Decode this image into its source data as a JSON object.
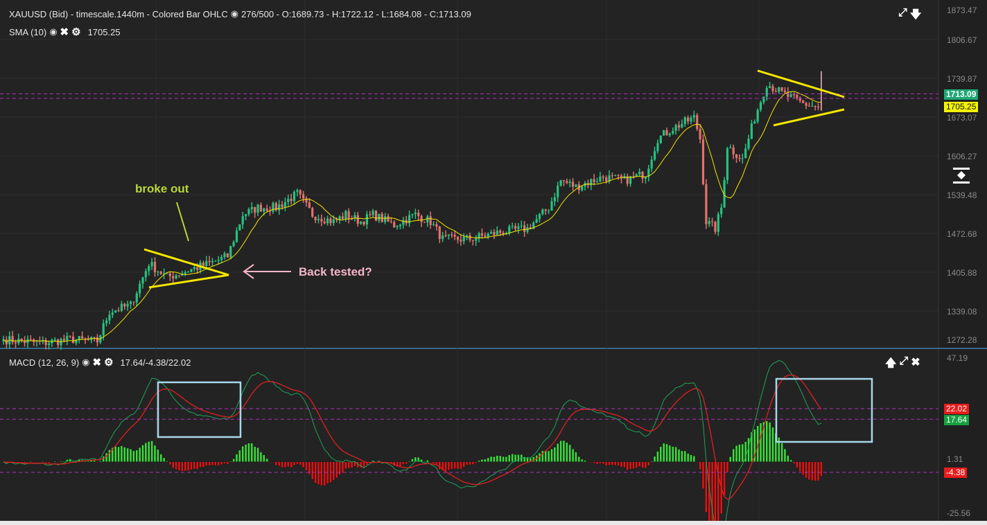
{
  "header": {
    "title": "XAUUSD (Bid) - timescale.1440m - Colored Bar OHLC",
    "ohlc": "276/500 - O:1689.73 - H:1722.12 - L:1684.08 - C:1713.09",
    "sma_label": "SMA (10)",
    "sma_value": "1705.25",
    "macd_label": "MACD (12, 26, 9)",
    "macd_values": "17.64/-4.38/22.02"
  },
  "price_tags": {
    "close": "1713.09",
    "sma": "1705.25"
  },
  "macd_tags": {
    "signal": "22.02",
    "macd": "17.64",
    "hist": "-4.38"
  },
  "annotations": {
    "broke_out": "broke out",
    "back_tested": "Back tested?"
  },
  "colors": {
    "up": "#26c281",
    "down": "#e3716c",
    "sma": "#f2e600",
    "macd": "#1fa35a",
    "signal": "#e02020",
    "hist_up": "#3ddc3d",
    "hist_down": "#e01515",
    "trendline": "#f5e600",
    "box": "#a8d8ea",
    "arrow": "#f7b6c8",
    "level": "#b030c0"
  },
  "chart_data": [
    {
      "type": "ohlc",
      "symbol": "XAUUSD",
      "bars_shown": 271,
      "price_ticks": [
        "1873.47",
        "1806.67",
        "1739.87",
        "1673.07",
        "1606.27",
        "1539.48",
        "1472.68",
        "1405.88",
        "1339.08",
        "1272.28"
      ],
      "ylim": [
        1270,
        1880
      ],
      "close_keypoints": [
        [
          0,
          1290
        ],
        [
          13,
          1284
        ],
        [
          22,
          1290
        ],
        [
          31,
          1287
        ],
        [
          35,
          1338
        ],
        [
          42,
          1349
        ],
        [
          48,
          1421
        ],
        [
          54,
          1397
        ],
        [
          61,
          1409
        ],
        [
          68,
          1421
        ],
        [
          74,
          1433
        ],
        [
          79,
          1505
        ],
        [
          84,
          1517
        ],
        [
          90,
          1517
        ],
        [
          97,
          1541
        ],
        [
          102,
          1505
        ],
        [
          109,
          1493
        ],
        [
          113,
          1505
        ],
        [
          118,
          1493
        ],
        [
          122,
          1505
        ],
        [
          129,
          1487
        ],
        [
          136,
          1505
        ],
        [
          141,
          1493
        ],
        [
          145,
          1463
        ],
        [
          154,
          1463
        ],
        [
          164,
          1475
        ],
        [
          173,
          1481
        ],
        [
          180,
          1517
        ],
        [
          184,
          1564
        ],
        [
          189,
          1553
        ],
        [
          198,
          1570
        ],
        [
          205,
          1564
        ],
        [
          212,
          1576
        ],
        [
          216,
          1636
        ],
        [
          221,
          1654
        ],
        [
          228,
          1672
        ],
        [
          230,
          1636
        ],
        [
          232,
          1493
        ],
        [
          235,
          1481
        ],
        [
          237,
          1517
        ],
        [
          239,
          1624
        ],
        [
          244,
          1600
        ],
        [
          248,
          1672
        ],
        [
          252,
          1731
        ],
        [
          257,
          1714
        ],
        [
          264,
          1696
        ],
        [
          269,
          1689.73
        ],
        [
          270,
          1713.09
        ]
      ],
      "last": {
        "open": 1689.73,
        "high": 1722.12,
        "low": 1684.08,
        "close": 1713.09
      },
      "sma_period": 10
    },
    {
      "type": "line",
      "indicator": "MACD",
      "params": [
        12,
        26,
        9
      ],
      "ticks": [
        "47.19",
        "1.31",
        "-25.56"
      ],
      "ylim": [
        -25.56,
        47.19
      ],
      "last": {
        "macd": 17.64,
        "histogram": -4.38,
        "signal": 22.02
      }
    }
  ]
}
